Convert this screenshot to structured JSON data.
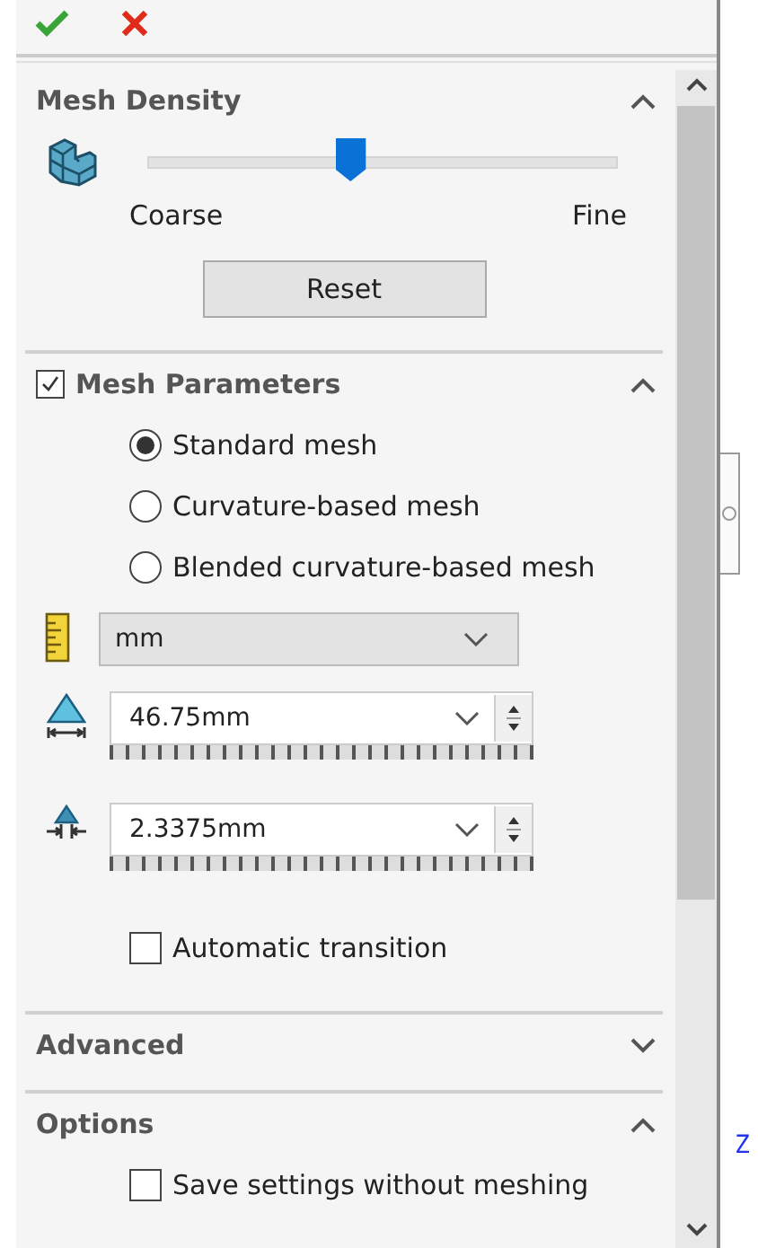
{
  "mesh_density": {
    "title": "Mesh Density",
    "expanded": true,
    "slider": {
      "level": 0.43
    },
    "min_label": "Coarse",
    "max_label": "Fine",
    "reset_button": "Reset"
  },
  "mesh_parameters": {
    "title": "Mesh Parameters",
    "checked": true,
    "expanded": true,
    "options": [
      {
        "label": "Standard mesh",
        "selected": true
      },
      {
        "label": "Curvature-based mesh",
        "selected": false
      },
      {
        "label": "Blended curvature-based mesh",
        "selected": false
      }
    ],
    "unit": "mm",
    "element_size": "46.75mm",
    "tolerance": "2.3375mm",
    "automatic_transition": {
      "label": "Automatic transition",
      "checked": false
    }
  },
  "advanced": {
    "title": "Advanced",
    "expanded": false
  },
  "options_section": {
    "title": "Options",
    "expanded": true,
    "save_settings": {
      "label": "Save settings without meshing",
      "checked": false
    }
  },
  "viewport": {
    "axis_label": "Z"
  }
}
